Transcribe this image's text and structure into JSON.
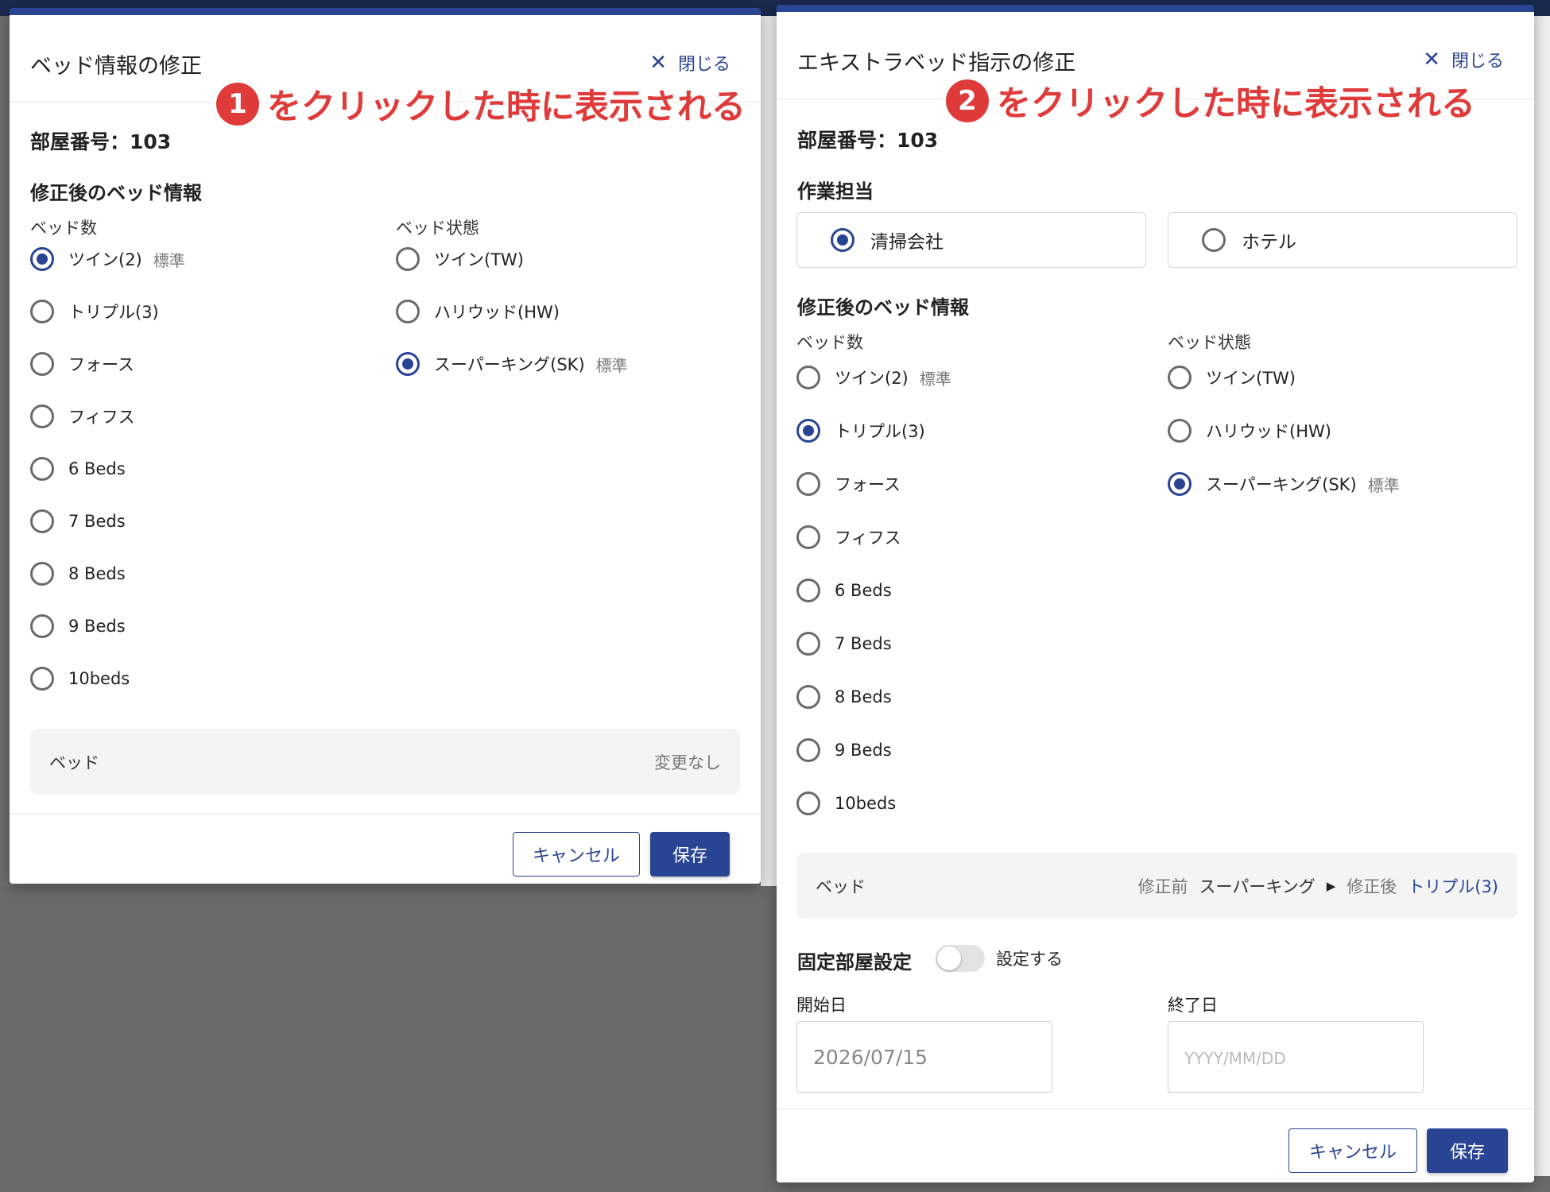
{
  "modal1": {
    "title": "ベッド情報の修正",
    "close_label": "閉じる",
    "room_label": "部屋番号：103",
    "section_title": "修正後のベッド情報",
    "bed_count_label": "ベッド数",
    "bed_state_label": "ベッド状態",
    "bed_count_options": [
      {
        "label": "ツイン(2)",
        "standard": "標準",
        "selected": true
      },
      {
        "label": "トリプル(3)",
        "standard": "",
        "selected": false
      },
      {
        "label": "フォース",
        "standard": "",
        "selected": false
      },
      {
        "label": "フィフス",
        "standard": "",
        "selected": false
      },
      {
        "label": "6 Beds",
        "standard": "",
        "selected": false
      },
      {
        "label": "7 Beds",
        "standard": "",
        "selected": false
      },
      {
        "label": "8 Beds",
        "standard": "",
        "selected": false
      },
      {
        "label": "9 Beds",
        "standard": "",
        "selected": false
      },
      {
        "label": "10beds",
        "standard": "",
        "selected": false
      }
    ],
    "bed_state_options": [
      {
        "label": "ツイン(TW)",
        "standard": "",
        "selected": false
      },
      {
        "label": "ハリウッド(HW)",
        "standard": "",
        "selected": false
      },
      {
        "label": "スーパーキング(SK)",
        "standard": "標準",
        "selected": true
      }
    ],
    "summary_label": "ベッド",
    "summary_value": "変更なし",
    "cancel_label": "キャンセル",
    "save_label": "保存"
  },
  "modal2": {
    "title": "エキストラベッド指示の修正",
    "close_label": "閉じる",
    "room_label": "部屋番号：103",
    "assign_title": "作業担当",
    "assign_options": [
      {
        "label": "清掃会社",
        "selected": true
      },
      {
        "label": "ホテル",
        "selected": false
      }
    ],
    "section_title": "修正後のベッド情報",
    "bed_count_label": "ベッド数",
    "bed_state_label": "ベッド状態",
    "bed_count_options": [
      {
        "label": "ツイン(2)",
        "standard": "標準",
        "selected": false
      },
      {
        "label": "トリプル(3)",
        "standard": "",
        "selected": true
      },
      {
        "label": "フォース",
        "standard": "",
        "selected": false
      },
      {
        "label": "フィフス",
        "standard": "",
        "selected": false
      },
      {
        "label": "6 Beds",
        "standard": "",
        "selected": false
      },
      {
        "label": "7 Beds",
        "standard": "",
        "selected": false
      },
      {
        "label": "8 Beds",
        "standard": "",
        "selected": false
      },
      {
        "label": "9 Beds",
        "standard": "",
        "selected": false
      },
      {
        "label": "10beds",
        "standard": "",
        "selected": false
      }
    ],
    "bed_state_options": [
      {
        "label": "ツイン(TW)",
        "standard": "",
        "selected": false
      },
      {
        "label": "ハリウッド(HW)",
        "standard": "",
        "selected": false
      },
      {
        "label": "スーパーキング(SK)",
        "standard": "標準",
        "selected": true
      }
    ],
    "summary_label": "ベッド",
    "before_label": "修正前",
    "before_value": "スーパーキング",
    "after_label": "修正後",
    "after_value": "トリプル(3)",
    "fixed_room_title": "固定部屋設定",
    "fixed_room_toggle_label": "設定する",
    "fixed_room_on": false,
    "start_label": "開始日",
    "start_value": "2026/07/15",
    "end_label": "終了日",
    "end_placeholder": "YYYY/MM/DD",
    "cancel_label": "キャンセル",
    "save_label": "保存"
  },
  "annotations": [
    {
      "number": "1",
      "text": "をクリックした時に表示される"
    },
    {
      "number": "2",
      "text": "をクリックした時に表示される"
    }
  ],
  "colors": {
    "accent": "#2a4494",
    "annotation": "#e03b3b"
  }
}
